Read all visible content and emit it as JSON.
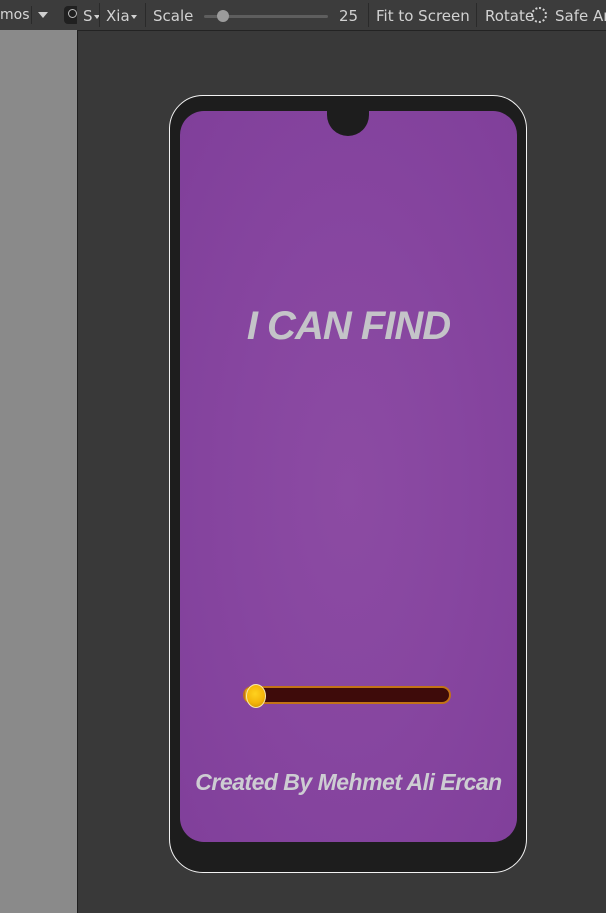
{
  "left_toolbar": {
    "gizmos_label": "mos"
  },
  "toolbar": {
    "aspect_label": "S",
    "device_label": "Xia",
    "scale_label": "Scale",
    "scale_value": "25",
    "scale_fraction": 0.15,
    "fit_label": "Fit to Screen",
    "rotate_label": "Rotate",
    "safe_area_label": "Safe Ar"
  },
  "game": {
    "title": "I CAN FIND",
    "credit": "Created By Mehmet Ali Ercan",
    "loading_progress": 0.04
  },
  "colors": {
    "screen_bg": "#8746a0",
    "bar_bg": "#3e0b0a",
    "bar_border": "#c27316",
    "knob": "#f4b50a",
    "title_text": "#c4c4c8"
  }
}
